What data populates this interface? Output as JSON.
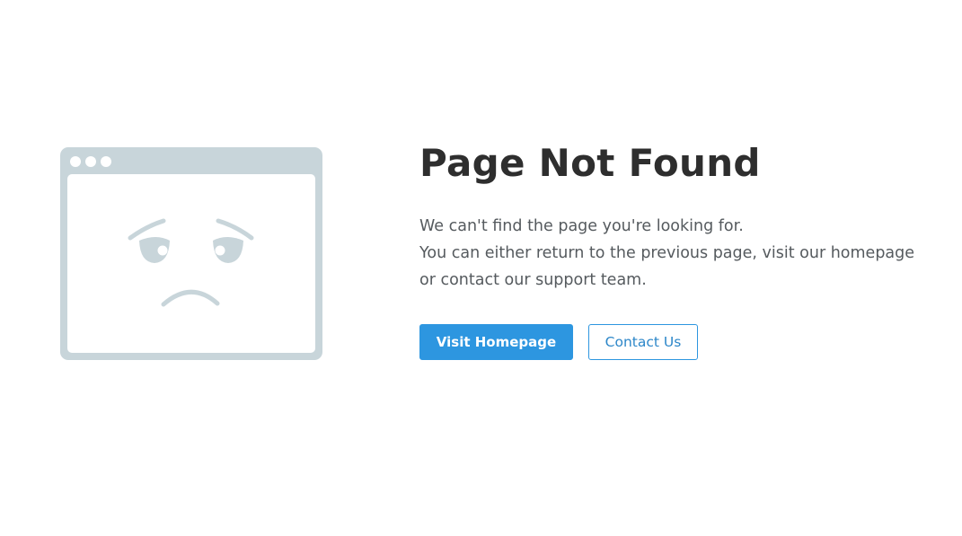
{
  "error": {
    "title": "Page Not Found",
    "message_lines": [
      "We can't find the page you're looking for.",
      "You can either return to the previous page, visit our homepage",
      "or contact our support team."
    ]
  },
  "actions": {
    "primary_label": "Visit Homepage",
    "secondary_label": "Contact Us"
  },
  "illustration": {
    "icon": "sad-browser-window-icon",
    "color": "#c8d5da"
  },
  "colors": {
    "accent": "#2d96e0",
    "title": "#2e2e2e",
    "text": "#555a5e"
  }
}
